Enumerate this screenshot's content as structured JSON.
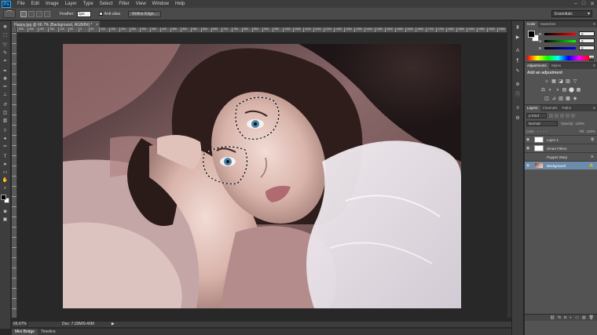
{
  "app": {
    "logo": "Ps"
  },
  "menu": [
    "File",
    "Edit",
    "Image",
    "Layer",
    "Type",
    "Select",
    "Filter",
    "View",
    "Window",
    "Help"
  ],
  "window_controls": [
    "–",
    "□",
    "✕"
  ],
  "options_bar": {
    "feather_label": "Feather:",
    "feather_value": "1px",
    "anti_alias": "Anti-alias",
    "refine_edge": "Refine Edge...",
    "workspace": "Essentials"
  },
  "document": {
    "tab_title": "Happy.jpg @ 66.7% (Background, RGB/8#) *",
    "close": "×"
  },
  "ruler_ticks": [
    "300",
    "250",
    "200",
    "150",
    "100",
    "50",
    "0",
    "50",
    "100",
    "150",
    "200",
    "250",
    "300",
    "350",
    "400",
    "450",
    "500",
    "550",
    "600",
    "650",
    "700",
    "750",
    "800",
    "850",
    "900",
    "950",
    "1000",
    "1050",
    "1100",
    "1150",
    "1200",
    "1250",
    "1300",
    "1350",
    "1400",
    "1450",
    "1500",
    "1550",
    "1600",
    "1650",
    "1700",
    "1750",
    "1800",
    "1850",
    "1900",
    "1950",
    "2000",
    "2050"
  ],
  "status": {
    "zoom": "66.67%",
    "doc_size": "Doc: 7.03M/9.40M",
    "arrow": "▶"
  },
  "bottom_tabs": [
    "Mini Bridge",
    "Timeline"
  ],
  "toolbox": [
    {
      "name": "move-tool-icon",
      "glyph": "✥"
    },
    {
      "name": "marquee-tool-icon",
      "glyph": "⬚"
    },
    {
      "name": "lasso-tool-icon",
      "glyph": "➰"
    },
    {
      "name": "quick-select-tool-icon",
      "glyph": "✎"
    },
    {
      "name": "crop-tool-icon",
      "glyph": "⌗"
    },
    {
      "name": "eyedropper-tool-icon",
      "glyph": "✒"
    },
    {
      "name": "healing-brush-tool-icon",
      "glyph": "✚"
    },
    {
      "name": "brush-tool-icon",
      "glyph": "✏"
    },
    {
      "name": "clone-stamp-tool-icon",
      "glyph": "⊥"
    },
    {
      "name": "history-brush-tool-icon",
      "glyph": "↺"
    },
    {
      "name": "eraser-tool-icon",
      "glyph": "◫"
    },
    {
      "name": "gradient-tool-icon",
      "glyph": "▥"
    },
    {
      "name": "blur-tool-icon",
      "glyph": "◊"
    },
    {
      "name": "dodge-tool-icon",
      "glyph": "●"
    },
    {
      "name": "pen-tool-icon",
      "glyph": "✑"
    },
    {
      "name": "type-tool-icon",
      "glyph": "T"
    },
    {
      "name": "path-select-tool-icon",
      "glyph": "➤"
    },
    {
      "name": "shape-tool-icon",
      "glyph": "▭"
    },
    {
      "name": "hand-tool-icon",
      "glyph": "✋"
    },
    {
      "name": "zoom-tool-icon",
      "glyph": "⌕"
    }
  ],
  "toolbox_bottom": [
    {
      "name": "quick-mask-icon",
      "glyph": "◙"
    },
    {
      "name": "screen-mode-icon",
      "glyph": "▣"
    }
  ],
  "dock": [
    {
      "name": "history-panel-icon",
      "glyph": "⧗"
    },
    {
      "name": "actions-panel-icon",
      "glyph": "▶"
    },
    {
      "name": "character-panel-icon",
      "glyph": "A"
    },
    {
      "name": "paragraph-panel-icon",
      "glyph": "¶"
    },
    {
      "name": "brush-panel-icon",
      "glyph": "✎"
    },
    {
      "name": "clone-source-panel-icon",
      "glyph": "⊕"
    },
    {
      "name": "info-panel-icon",
      "glyph": "ⓘ"
    },
    {
      "name": "properties-panel-icon",
      "glyph": "≡"
    },
    {
      "name": "tool-presets-icon",
      "glyph": "⚙"
    }
  ],
  "color_panel": {
    "tabs": [
      "Color",
      "Swatches"
    ],
    "menu": "≡",
    "channels": [
      {
        "label": "R",
        "value": "0",
        "gradient": "linear-gradient(to right,#000,#ff0000)"
      },
      {
        "label": "G",
        "value": "0",
        "gradient": "linear-gradient(to right,#000,#00ff00)"
      },
      {
        "label": "B",
        "value": "0",
        "gradient": "linear-gradient(to right,#000,#0000ff)"
      }
    ]
  },
  "adjustments_panel": {
    "tabs": [
      "Adjustments",
      "Styles"
    ],
    "title": "Add an adjustment",
    "row1": [
      "☼",
      "▦",
      "◪",
      "▨",
      "▽"
    ],
    "row2": [
      "⚖",
      "◐",
      "◑",
      "▤",
      "⬤",
      "▦"
    ],
    "row3": [
      "◫",
      "⊿",
      "▥",
      "▩",
      "◈"
    ]
  },
  "layers_panel": {
    "tabs": [
      "Layers",
      "Channels",
      "Paths"
    ],
    "kind": "ρ Kind",
    "blend_mode": "Normal",
    "opacity_label": "Opacity:",
    "opacity_value": "100%",
    "lock_label": "Lock:",
    "fill_label": "Fill:",
    "fill_value": "100%",
    "layers": [
      {
        "name": "Layer 1",
        "thumb": "white",
        "indent": false,
        "selected": false,
        "italic": false,
        "visible": true,
        "badge": "⧉"
      },
      {
        "name": "Smart Filters",
        "thumb": "mask",
        "indent": true,
        "selected": false,
        "italic": false,
        "visible": true,
        "badge": ""
      },
      {
        "name": "Puppet Warp",
        "thumb": "none",
        "indent": true,
        "selected": false,
        "italic": false,
        "visible": false,
        "badge": "≋"
      },
      {
        "name": "Background",
        "thumb": "photo",
        "indent": false,
        "selected": true,
        "italic": true,
        "visible": true,
        "badge": "🔒"
      }
    ],
    "footer": [
      "⛓",
      "fx",
      "◘",
      "◐",
      "▭",
      "▤",
      "🗑"
    ]
  },
  "accent_colors": {
    "selection": "#6d8cab",
    "panel": "#535353",
    "canvas_bg": "#282828"
  }
}
